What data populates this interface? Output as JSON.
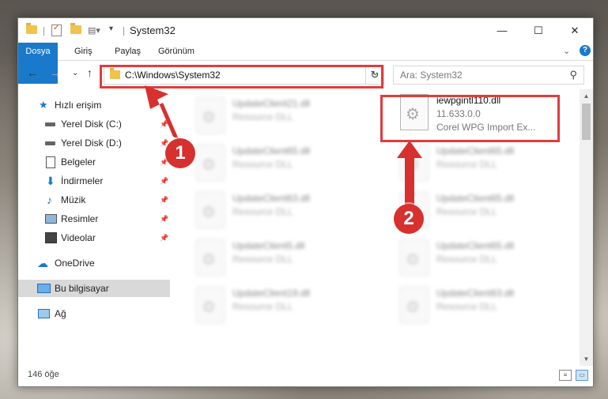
{
  "window": {
    "title": "System32",
    "controls": {
      "minimize": "—",
      "maximize": "☐",
      "close": "✕"
    }
  },
  "ribbon": {
    "tabs": [
      "Dosya",
      "Giriş",
      "Paylaş",
      "Görünüm"
    ],
    "expand": "⌄",
    "help": "?"
  },
  "navbar": {
    "back": "←",
    "forward": "→",
    "recent": "⌄",
    "up": "↑",
    "address": "C:\\Windows\\System32",
    "address_chevron": "⌄",
    "refresh": "↻",
    "search_placeholder": "Ara: System32",
    "search_icon": "⚲"
  },
  "sidebar": {
    "items": [
      {
        "label": "Hızlı erişim",
        "icon": "star-icon",
        "pin": ""
      },
      {
        "label": "Yerel Disk (C:)",
        "icon": "drive-icon",
        "pin": "📌"
      },
      {
        "label": "Yerel Disk (D:)",
        "icon": "drive-icon",
        "pin": "📌"
      },
      {
        "label": "Belgeler",
        "icon": "documents-icon",
        "pin": "📌"
      },
      {
        "label": "İndirmeler",
        "icon": "download-icon",
        "pin": "📌"
      },
      {
        "label": "Müzik",
        "icon": "music-icon",
        "pin": "📌"
      },
      {
        "label": "Resimler",
        "icon": "pictures-icon",
        "pin": "📌"
      },
      {
        "label": "Videolar",
        "icon": "videos-icon",
        "pin": "📌"
      },
      {
        "label": "OneDrive",
        "icon": "cloud-icon",
        "pin": ""
      },
      {
        "label": "Bu bilgisayar",
        "icon": "computer-icon",
        "pin": "",
        "selected": true
      },
      {
        "label": "Ağ",
        "icon": "network-icon",
        "pin": ""
      }
    ]
  },
  "files": {
    "highlighted": {
      "name": "iewpgintl110.dll",
      "type": "11.633.0.0",
      "desc": "Corel WPG Import Ex..."
    },
    "left_column": [
      {
        "name": "UpdateClient21.dll",
        "type": "Resource DLL"
      },
      {
        "name": "UpdateClient65.dll",
        "type": "Resource DLL"
      },
      {
        "name": "UpdateClient63.dll",
        "type": "Resource DLL"
      },
      {
        "name": "UpdateClient5.dll",
        "type": "Resource DLL"
      },
      {
        "name": "UpdateClient19.dll",
        "type": "Resource DLL"
      }
    ],
    "right_column": [
      {
        "name": "UpdateClient65.dll",
        "type": "Resource DLL"
      },
      {
        "name": "UpdateClient65.dll",
        "type": "Resource DLL"
      },
      {
        "name": "UpdateClient65.dll",
        "type": "Resource DLL"
      },
      {
        "name": "UpdateClient63.dll",
        "type": "Resource DLL"
      }
    ]
  },
  "status": {
    "count": "146 öğe"
  },
  "callouts": {
    "one": "1",
    "two": "2"
  },
  "colors": {
    "accent": "#1979ca",
    "highlight": "#e03c3c",
    "callout": "#d6302f"
  }
}
